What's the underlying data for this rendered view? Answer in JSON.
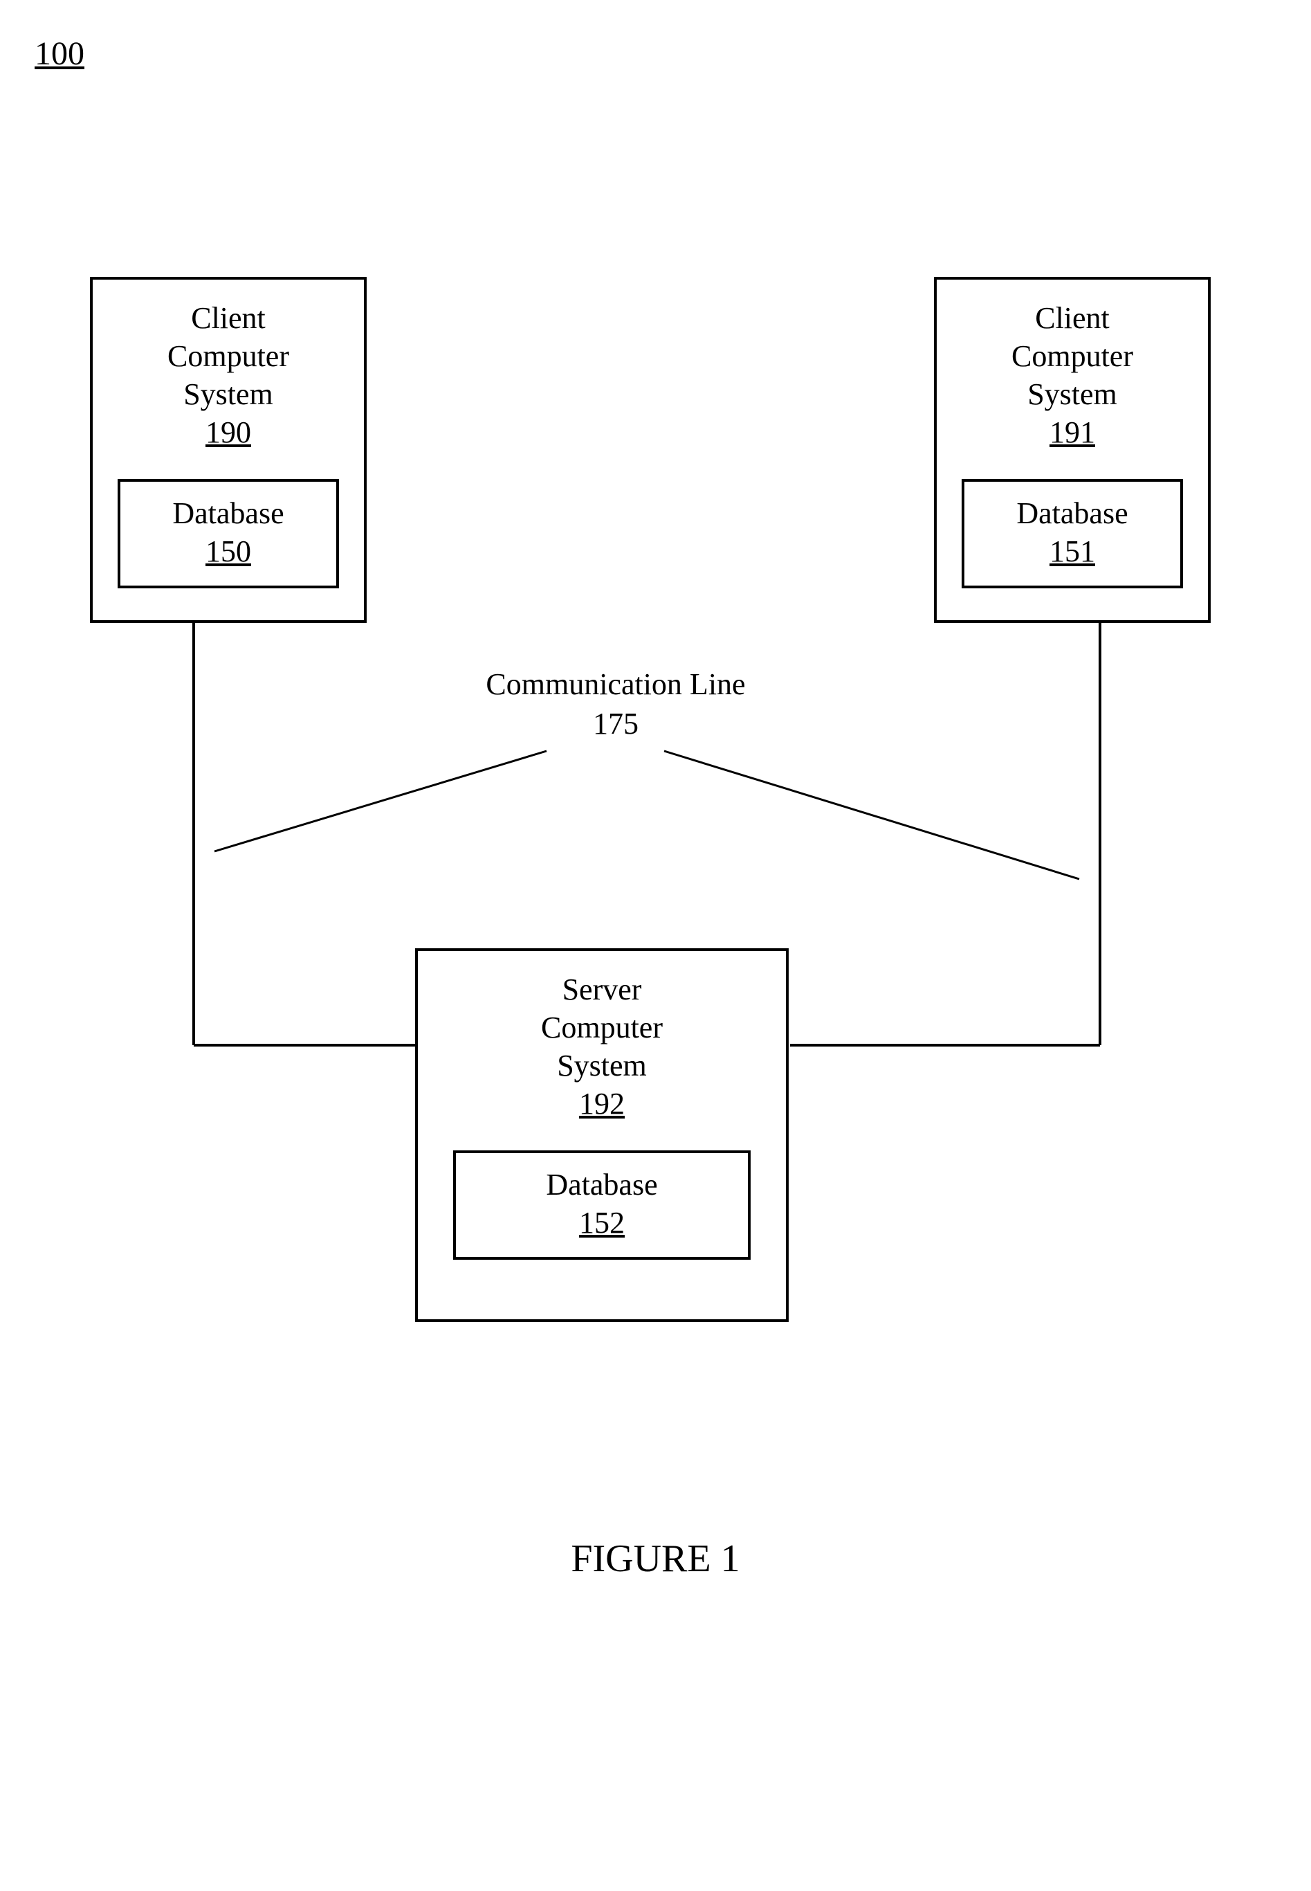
{
  "figure_reference": "100",
  "figure_caption": "FIGURE 1",
  "communication": {
    "label_line1": "Communication Line",
    "label_line2": "175"
  },
  "nodes": {
    "client_left": {
      "title_line1": "Client",
      "title_line2": "Computer",
      "title_line3": "System",
      "ref": "190",
      "db_label": "Database",
      "db_ref": "150"
    },
    "client_right": {
      "title_line1": "Client",
      "title_line2": "Computer",
      "title_line3": "System",
      "ref": "191",
      "db_label": "Database",
      "db_ref": "151"
    },
    "server": {
      "title_line1": "Server",
      "title_line2": "Computer",
      "title_line3": "System",
      "ref": "192",
      "db_label": "Database",
      "db_ref": "152"
    }
  }
}
